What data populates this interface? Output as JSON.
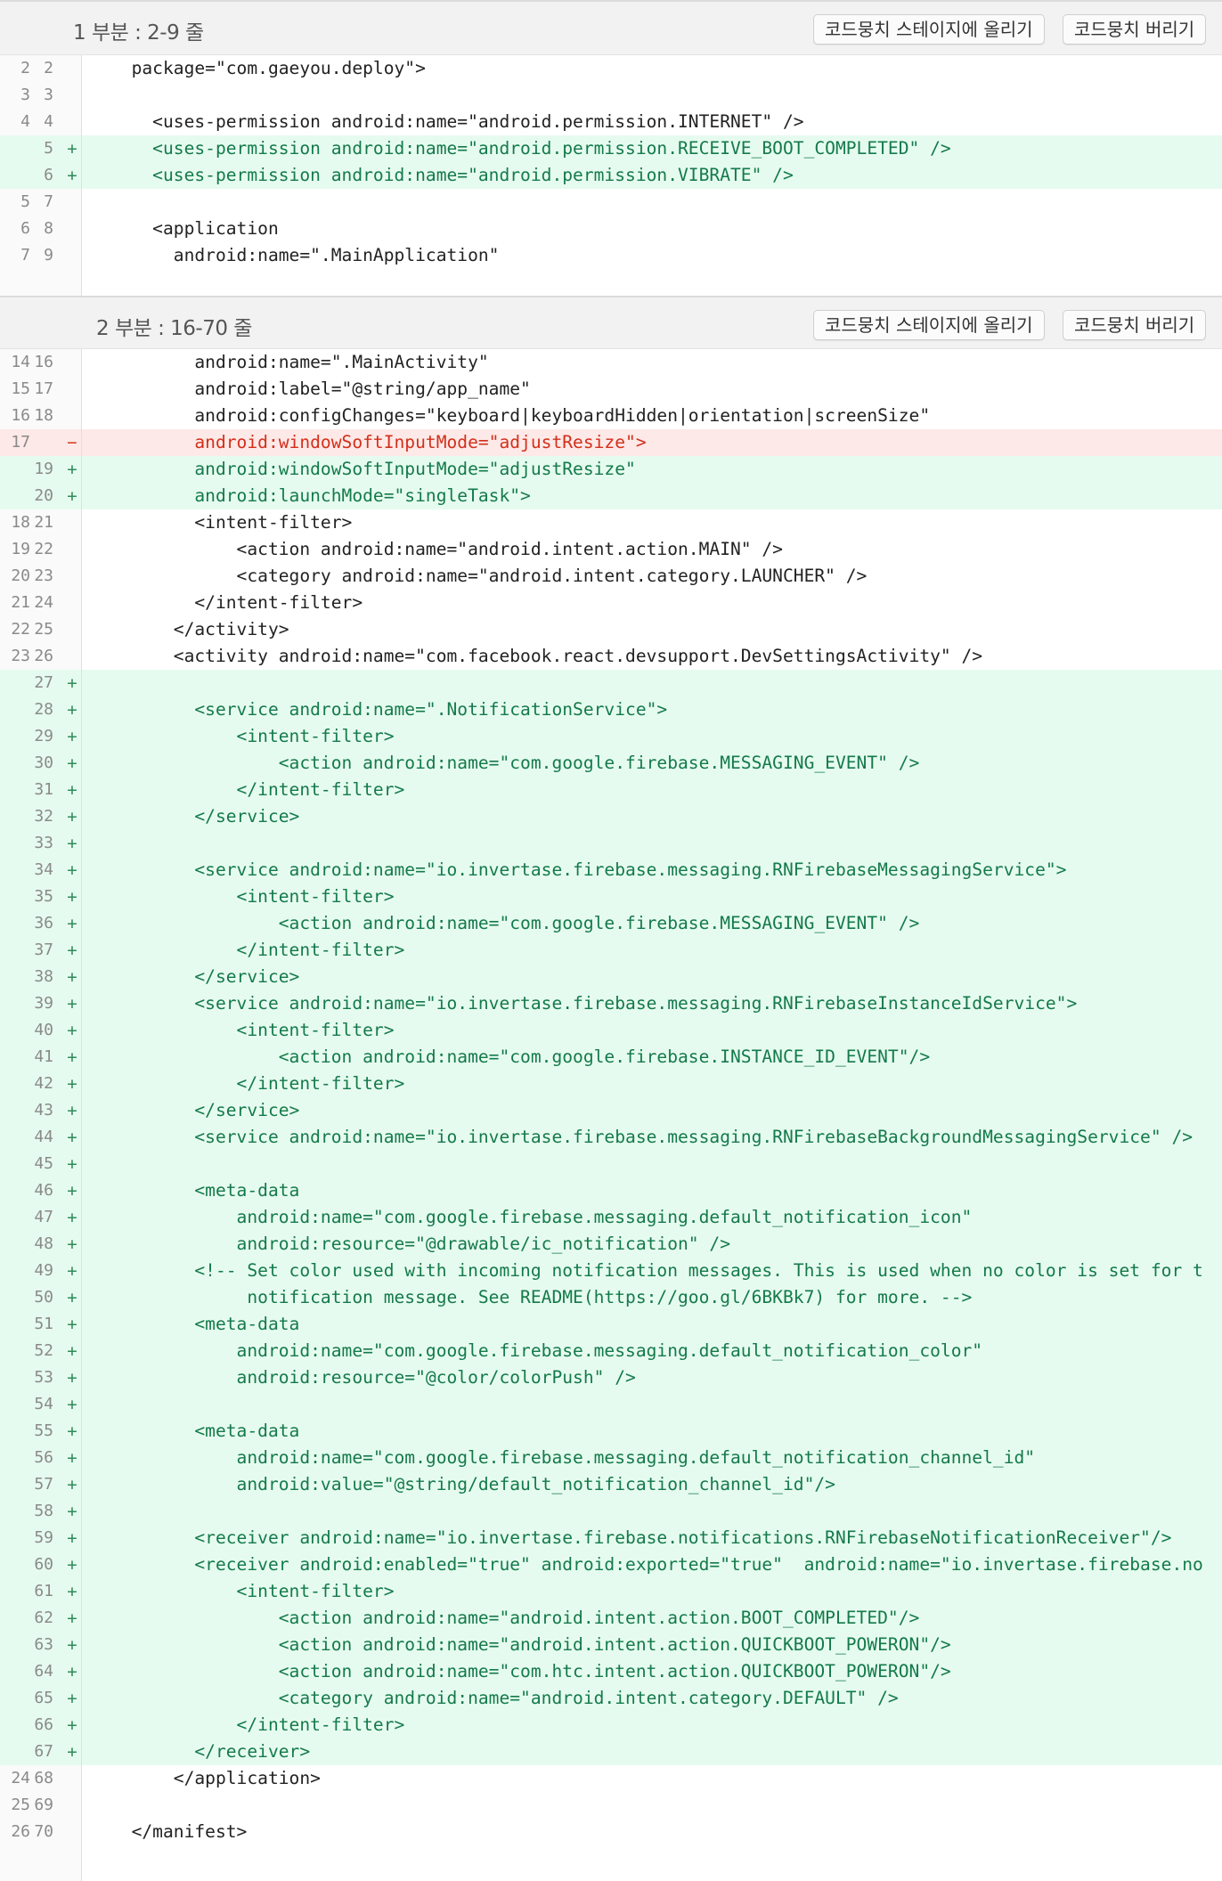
{
  "hunks": [
    {
      "title": "1 부분 : 2-9 줄",
      "stage_label": "코드뭉치 스테이지에 올리기",
      "discard_label": "코드뭉치 버리기",
      "lines": [
        {
          "old": "2",
          "new": "2",
          "type": "ctx",
          "text": "  package=\"com.gaeyou.deploy\">"
        },
        {
          "old": "3",
          "new": "3",
          "type": "ctx",
          "text": ""
        },
        {
          "old": "4",
          "new": "4",
          "type": "ctx",
          "text": "    <uses-permission android:name=\"android.permission.INTERNET\" />"
        },
        {
          "old": "",
          "new": "5",
          "type": "add",
          "text": "    <uses-permission android:name=\"android.permission.RECEIVE_BOOT_COMPLETED\" />"
        },
        {
          "old": "",
          "new": "6",
          "type": "add",
          "text": "    <uses-permission android:name=\"android.permission.VIBRATE\" />"
        },
        {
          "old": "5",
          "new": "7",
          "type": "ctx",
          "text": ""
        },
        {
          "old": "6",
          "new": "8",
          "type": "ctx",
          "text": "    <application"
        },
        {
          "old": "7",
          "new": "9",
          "type": "ctx",
          "text": "      android:name=\".MainApplication\""
        }
      ]
    },
    {
      "title": "2 부분 : 16-70 줄",
      "stage_label": "코드뭉치 스테이지에 올리기",
      "discard_label": "코드뭉치 버리기",
      "lines": [
        {
          "old": "14",
          "new": "16",
          "type": "ctx",
          "text": "        android:name=\".MainActivity\""
        },
        {
          "old": "15",
          "new": "17",
          "type": "ctx",
          "text": "        android:label=\"@string/app_name\""
        },
        {
          "old": "16",
          "new": "18",
          "type": "ctx",
          "text": "        android:configChanges=\"keyboard|keyboardHidden|orientation|screenSize\""
        },
        {
          "old": "17",
          "new": "",
          "type": "del",
          "text": "        android:windowSoftInputMode=\"adjustResize\">"
        },
        {
          "old": "",
          "new": "19",
          "type": "add",
          "text": "        android:windowSoftInputMode=\"adjustResize\""
        },
        {
          "old": "",
          "new": "20",
          "type": "add",
          "text": "        android:launchMode=\"singleTask\">"
        },
        {
          "old": "18",
          "new": "21",
          "type": "ctx",
          "text": "        <intent-filter>"
        },
        {
          "old": "19",
          "new": "22",
          "type": "ctx",
          "text": "            <action android:name=\"android.intent.action.MAIN\" />"
        },
        {
          "old": "20",
          "new": "23",
          "type": "ctx",
          "text": "            <category android:name=\"android.intent.category.LAUNCHER\" />"
        },
        {
          "old": "21",
          "new": "24",
          "type": "ctx",
          "text": "        </intent-filter>"
        },
        {
          "old": "22",
          "new": "25",
          "type": "ctx",
          "text": "      </activity>"
        },
        {
          "old": "23",
          "new": "26",
          "type": "ctx",
          "text": "      <activity android:name=\"com.facebook.react.devsupport.DevSettingsActivity\" />"
        },
        {
          "old": "",
          "new": "27",
          "type": "add",
          "text": ""
        },
        {
          "old": "",
          "new": "28",
          "type": "add",
          "text": "        <service android:name=\".NotificationService\">"
        },
        {
          "old": "",
          "new": "29",
          "type": "add",
          "text": "            <intent-filter>"
        },
        {
          "old": "",
          "new": "30",
          "type": "add",
          "text": "                <action android:name=\"com.google.firebase.MESSAGING_EVENT\" />"
        },
        {
          "old": "",
          "new": "31",
          "type": "add",
          "text": "            </intent-filter>"
        },
        {
          "old": "",
          "new": "32",
          "type": "add",
          "text": "        </service>"
        },
        {
          "old": "",
          "new": "33",
          "type": "add",
          "text": ""
        },
        {
          "old": "",
          "new": "34",
          "type": "add",
          "text": "        <service android:name=\"io.invertase.firebase.messaging.RNFirebaseMessagingService\">"
        },
        {
          "old": "",
          "new": "35",
          "type": "add",
          "text": "            <intent-filter>"
        },
        {
          "old": "",
          "new": "36",
          "type": "add",
          "text": "                <action android:name=\"com.google.firebase.MESSAGING_EVENT\" />"
        },
        {
          "old": "",
          "new": "37",
          "type": "add",
          "text": "            </intent-filter>"
        },
        {
          "old": "",
          "new": "38",
          "type": "add",
          "text": "        </service>"
        },
        {
          "old": "",
          "new": "39",
          "type": "add",
          "text": "        <service android:name=\"io.invertase.firebase.messaging.RNFirebaseInstanceIdService\">"
        },
        {
          "old": "",
          "new": "40",
          "type": "add",
          "text": "            <intent-filter>"
        },
        {
          "old": "",
          "new": "41",
          "type": "add",
          "text": "                <action android:name=\"com.google.firebase.INSTANCE_ID_EVENT\"/>"
        },
        {
          "old": "",
          "new": "42",
          "type": "add",
          "text": "            </intent-filter>"
        },
        {
          "old": "",
          "new": "43",
          "type": "add",
          "text": "        </service>"
        },
        {
          "old": "",
          "new": "44",
          "type": "add",
          "text": "        <service android:name=\"io.invertase.firebase.messaging.RNFirebaseBackgroundMessagingService\" />"
        },
        {
          "old": "",
          "new": "45",
          "type": "add",
          "text": ""
        },
        {
          "old": "",
          "new": "46",
          "type": "add",
          "text": "        <meta-data"
        },
        {
          "old": "",
          "new": "47",
          "type": "add",
          "text": "            android:name=\"com.google.firebase.messaging.default_notification_icon\""
        },
        {
          "old": "",
          "new": "48",
          "type": "add",
          "text": "            android:resource=\"@drawable/ic_notification\" />"
        },
        {
          "old": "",
          "new": "49",
          "type": "add",
          "text": "        <!-- Set color used with incoming notification messages. This is used when no color is set for t"
        },
        {
          "old": "",
          "new": "50",
          "type": "add",
          "text": "             notification message. See README(https://goo.gl/6BKBk7) for more. -->"
        },
        {
          "old": "",
          "new": "51",
          "type": "add",
          "text": "        <meta-data"
        },
        {
          "old": "",
          "new": "52",
          "type": "add",
          "text": "            android:name=\"com.google.firebase.messaging.default_notification_color\""
        },
        {
          "old": "",
          "new": "53",
          "type": "add",
          "text": "            android:resource=\"@color/colorPush\" />"
        },
        {
          "old": "",
          "new": "54",
          "type": "add",
          "text": ""
        },
        {
          "old": "",
          "new": "55",
          "type": "add",
          "text": "        <meta-data"
        },
        {
          "old": "",
          "new": "56",
          "type": "add",
          "text": "            android:name=\"com.google.firebase.messaging.default_notification_channel_id\""
        },
        {
          "old": "",
          "new": "57",
          "type": "add",
          "text": "            android:value=\"@string/default_notification_channel_id\"/>"
        },
        {
          "old": "",
          "new": "58",
          "type": "add",
          "text": ""
        },
        {
          "old": "",
          "new": "59",
          "type": "add",
          "text": "        <receiver android:name=\"io.invertase.firebase.notifications.RNFirebaseNotificationReceiver\"/>"
        },
        {
          "old": "",
          "new": "60",
          "type": "add",
          "text": "        <receiver android:enabled=\"true\" android:exported=\"true\"  android:name=\"io.invertase.firebase.no"
        },
        {
          "old": "",
          "new": "61",
          "type": "add",
          "text": "            <intent-filter>"
        },
        {
          "old": "",
          "new": "62",
          "type": "add",
          "text": "                <action android:name=\"android.intent.action.BOOT_COMPLETED\"/>"
        },
        {
          "old": "",
          "new": "63",
          "type": "add",
          "text": "                <action android:name=\"android.intent.action.QUICKBOOT_POWERON\"/>"
        },
        {
          "old": "",
          "new": "64",
          "type": "add",
          "text": "                <action android:name=\"com.htc.intent.action.QUICKBOOT_POWERON\"/>"
        },
        {
          "old": "",
          "new": "65",
          "type": "add",
          "text": "                <category android:name=\"android.intent.category.DEFAULT\" />"
        },
        {
          "old": "",
          "new": "66",
          "type": "add",
          "text": "            </intent-filter>"
        },
        {
          "old": "",
          "new": "67",
          "type": "add",
          "text": "        </receiver>"
        },
        {
          "old": "24",
          "new": "68",
          "type": "ctx",
          "text": "      </application>"
        },
        {
          "old": "25",
          "new": "69",
          "type": "ctx",
          "text": ""
        },
        {
          "old": "26",
          "new": "70",
          "type": "ctx",
          "text": "  </manifest>"
        }
      ]
    }
  ],
  "colors": {
    "added_bg": "#e6fbef",
    "added_text": "#147a4b",
    "removed_bg": "#fde9e7",
    "removed_text": "#d32f1b"
  }
}
